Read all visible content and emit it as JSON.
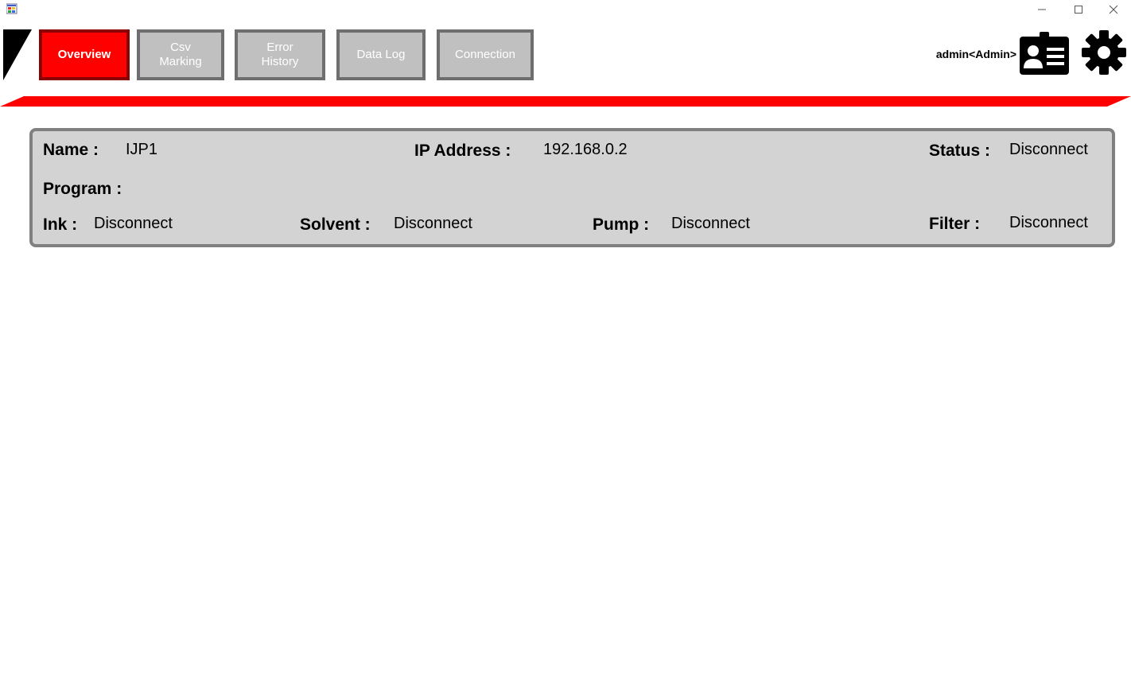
{
  "window": {
    "controls": {
      "minimize": "—",
      "maximize": "☐",
      "close": "✕"
    }
  },
  "nav": {
    "items": [
      {
        "label_lines": [
          "Overview"
        ],
        "active": true
      },
      {
        "label_lines": [
          "Csv",
          "Marking"
        ],
        "active": false
      },
      {
        "label_lines": [
          "Error",
          "History"
        ],
        "active": false
      },
      {
        "label_lines": [
          "Data Log"
        ],
        "active": false
      },
      {
        "label_lines": [
          "Connection"
        ],
        "active": false
      }
    ]
  },
  "user": {
    "label": "admin<Admin>",
    "profile_icon": "id-card-icon",
    "settings_icon": "gear-icon"
  },
  "colors": {
    "accent": "#ff0000",
    "accent_dark": "#8b0000",
    "nav_inactive_bg": "#c0c0c0",
    "nav_border": "#6e6e6e",
    "panel_bg": "#d3d3d3",
    "panel_border": "#808080"
  },
  "device": {
    "name_label": "Name :",
    "name_value": "IJP1",
    "ip_label": "IP Address :",
    "ip_value": "192.168.0.2",
    "status_label": "Status :",
    "status_value": "Disconnect",
    "program_label": "Program :",
    "program_value": "",
    "ink_label": "Ink :",
    "ink_value": "Disconnect",
    "solvent_label": "Solvent :",
    "solvent_value": "Disconnect",
    "pump_label": "Pump :",
    "pump_value": "Disconnect",
    "filter_label": "Filter :",
    "filter_value": "Disconnect"
  }
}
